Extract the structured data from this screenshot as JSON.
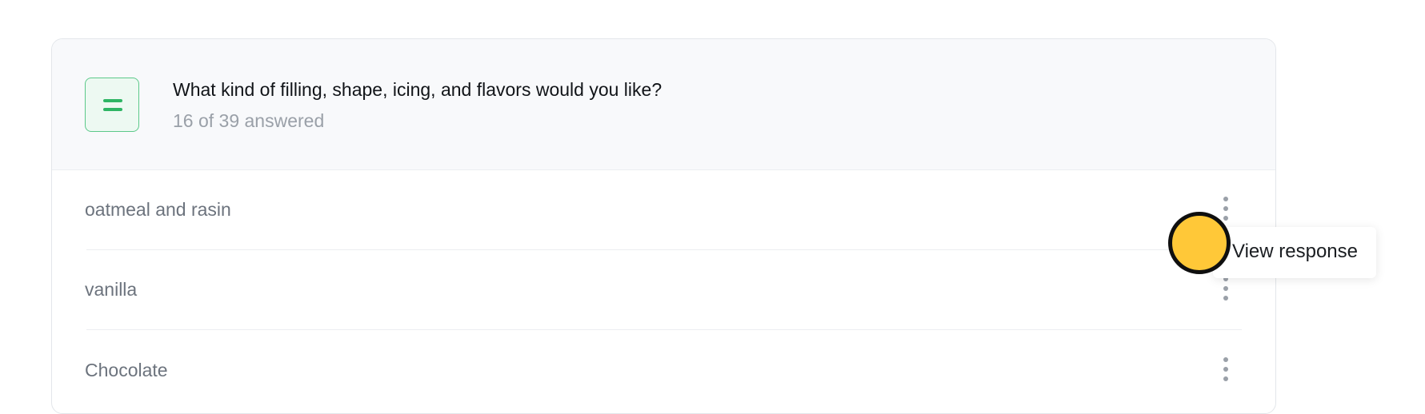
{
  "question": {
    "icon": "long-text-icon",
    "title": "What kind of filling, shape, icing, and flavors would you like?",
    "answered": "16 of 39 answered"
  },
  "responses": [
    {
      "text": "oatmeal and rasin",
      "menu_icon": "kebab-menu-icon"
    },
    {
      "text": "vanilla",
      "menu_icon": "kebab-menu-icon"
    },
    {
      "text": "Chocolate",
      "menu_icon": "kebab-menu-icon"
    }
  ],
  "tooltip": {
    "label": "View response"
  },
  "colors": {
    "accent_green": "#2fb565",
    "cursor_yellow": "#ffc838",
    "header_bg": "#f8f9fb"
  }
}
